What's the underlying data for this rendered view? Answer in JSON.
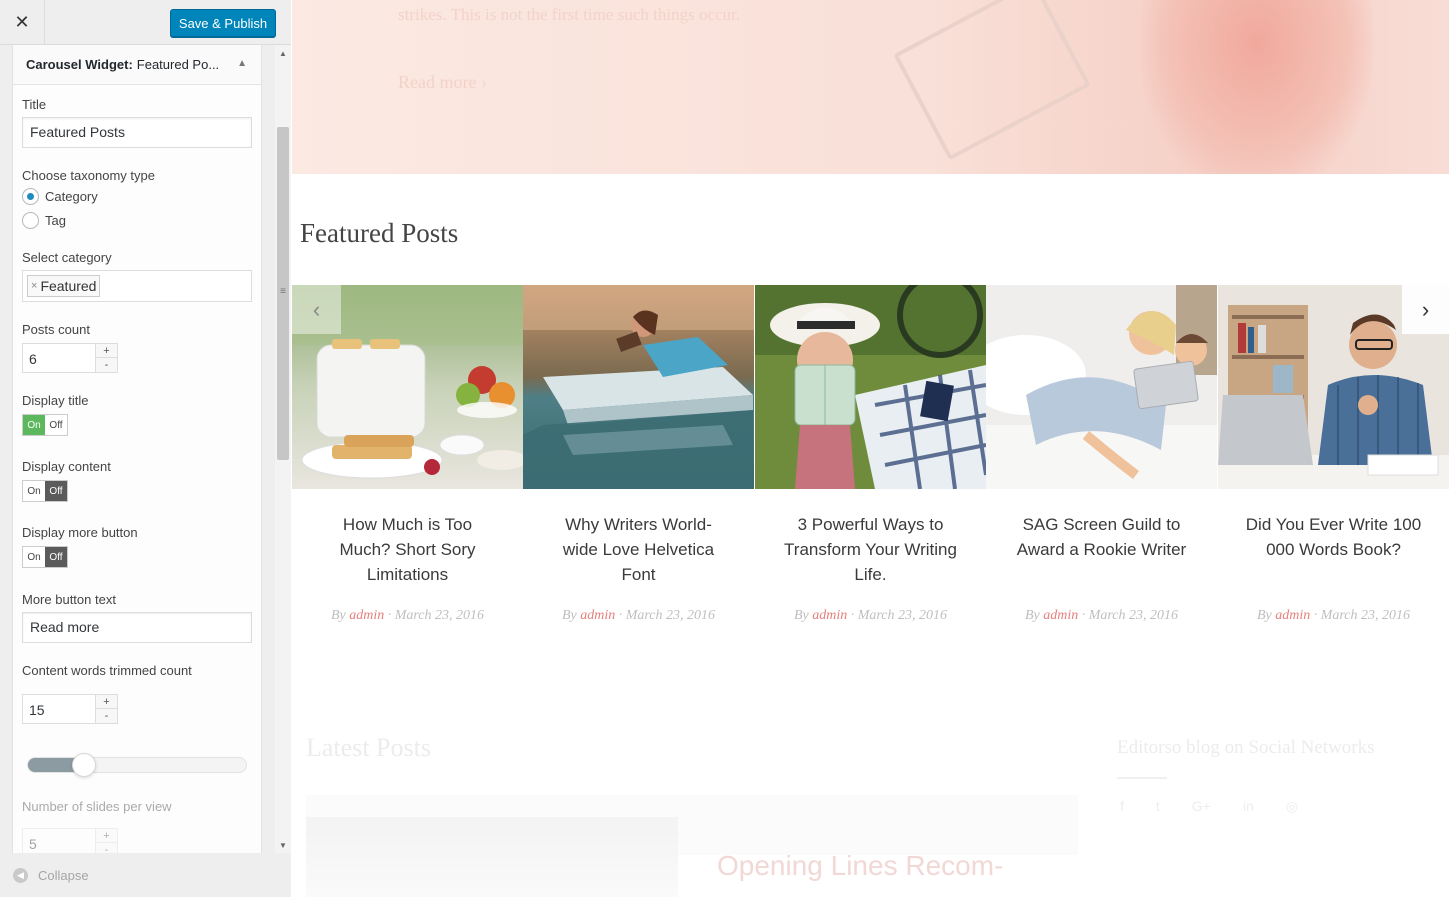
{
  "topbar": {
    "close_label": "✕",
    "publish_label": "Save & Publish"
  },
  "widget": {
    "header_prefix": "Carousel Widget:",
    "header_title": "Featured Po...",
    "title_label": "Title",
    "title_value": "Featured Posts",
    "taxonomy_label": "Choose taxonomy type",
    "taxonomy_options": [
      {
        "label": "Category",
        "selected": true
      },
      {
        "label": "Tag",
        "selected": false
      }
    ],
    "category_label": "Select category",
    "category_tag": "Featured",
    "category_tag_remove": "×",
    "posts_count_label": "Posts count",
    "posts_count_value": "6",
    "display_title_label": "Display title",
    "display_content_label": "Display content",
    "display_more_label": "Display more button",
    "toggle_on": "On",
    "toggle_off": "Off",
    "display_title": true,
    "display_content": false,
    "display_more": false,
    "more_text_label": "More button text",
    "more_text_value": "Read more",
    "trim_label": "Content words trimmed count",
    "trim_value": "15",
    "slides_label": "Number of slides per view",
    "slides_value": "5",
    "stepper_plus": "+",
    "stepper_minus": "-"
  },
  "footer": {
    "collapse_label": "Collapse"
  },
  "preview": {
    "hero_text": "strikes. This is not the first time such things occur.",
    "hero_readmore": "Read more  ›",
    "section_title": "Featured Posts",
    "prev_arrow": "‹",
    "next_arrow": "›",
    "slides": [
      {
        "title": "How Much is Too Much? Short Sory Limitations",
        "by": "By",
        "author": "admin",
        "date": "March 23, 2016"
      },
      {
        "title": "Why Writers World-wide Love Helvetica Font",
        "by": "By",
        "author": "admin",
        "date": "March 23, 2016"
      },
      {
        "title": "3 Powerful Ways to Transform Your Writing Life.",
        "by": "By",
        "author": "admin",
        "date": "March 23, 2016"
      },
      {
        "title": "SAG Screen Guild to Award a Rookie Writer",
        "by": "By",
        "author": "admin",
        "date": "March 23, 2016"
      },
      {
        "title": "Did You Ever Write 100 000 Words Book?",
        "by": "By",
        "author": "admin",
        "date": "March 23, 2016"
      }
    ],
    "latest_title": "Latest Posts",
    "social_title": "Editorso blog on Social Networks",
    "social_icons": [
      "f",
      "t",
      "G+",
      "in",
      "◎"
    ],
    "latest_post_title": "Opening Lines Recom-"
  },
  "colors": {
    "primary": "#0085ba",
    "toggle_on": "#5cb85c",
    "toggle_off": "#5b5b5b",
    "author": "#e57f7b"
  }
}
